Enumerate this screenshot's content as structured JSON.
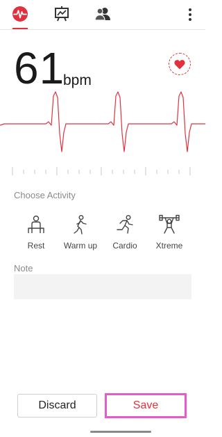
{
  "tabs": [
    {
      "name": "heart-rate",
      "icon": "ecg-icon",
      "active": true
    },
    {
      "name": "history",
      "icon": "chart-icon",
      "active": false
    },
    {
      "name": "profiles",
      "icon": "people-icon",
      "active": false
    }
  ],
  "colors": {
    "accent": "#e1313d",
    "highlight": "#e55bcc",
    "note_bg": "#f3f3f3"
  },
  "reading": {
    "value": "61",
    "unit": "bpm"
  },
  "activity_section": {
    "label": "Choose Activity",
    "items": [
      {
        "label": "Rest",
        "icon": "rest-icon"
      },
      {
        "label": "Warm up",
        "icon": "walking-icon"
      },
      {
        "label": "Cardio",
        "icon": "running-icon"
      },
      {
        "label": "Xtreme",
        "icon": "weightlifting-icon"
      }
    ]
  },
  "note": {
    "label": "Note",
    "value": "",
    "placeholder": ""
  },
  "actions": {
    "discard_label": "Discard",
    "save_label": "Save"
  }
}
